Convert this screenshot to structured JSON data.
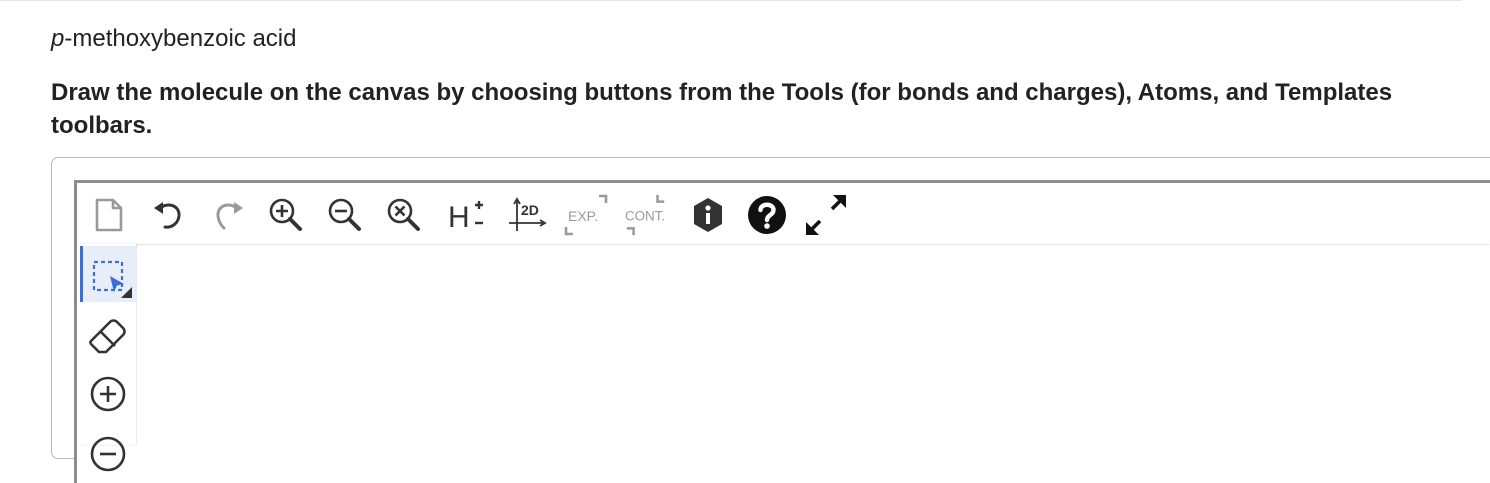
{
  "question": {
    "compound_prefix": "p",
    "compound_rest": "-methoxybenzoic acid",
    "instructions": "Draw the molecule on the canvas by choosing buttons from the Tools (for bonds and charges), Atoms, and Templates toolbars."
  },
  "toolbar": {
    "new_icon": "new-document-icon",
    "undo_icon": "undo-icon",
    "redo_icon": "redo-icon",
    "zoom_in_icon": "zoom-in-icon",
    "zoom_out_icon": "zoom-out-icon",
    "zoom_reset_icon": "zoom-reset-icon",
    "hydrogens_label": "H",
    "clean_2d_label": "2D",
    "expand_label": "EXP.",
    "contract_label": "CONT.",
    "info_icon": "info-icon",
    "help_icon": "help-icon",
    "fullscreen_icon": "fullscreen-icon"
  },
  "tools": {
    "select_icon": "rectangle-select-icon",
    "erase_icon": "eraser-icon",
    "charge_plus_icon": "charge-plus-icon",
    "charge_minus_icon": "charge-minus-icon"
  },
  "colors": {
    "accent": "#3a6fd8",
    "icon": "#333333",
    "icon_disabled": "#9a9a9a",
    "border": "#8d8d8d"
  }
}
